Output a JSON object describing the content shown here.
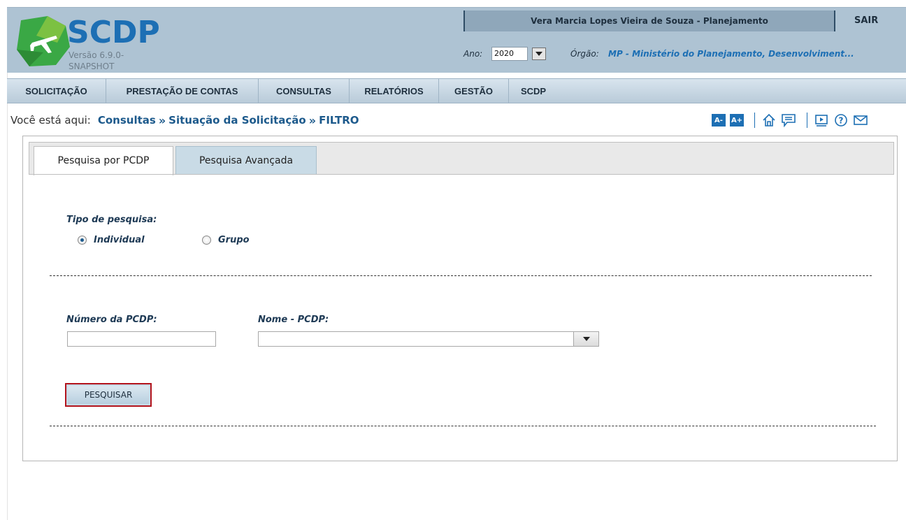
{
  "app": {
    "logo_title": "SCDP",
    "version": "Versão 6.9.0-SNAPSHOT"
  },
  "header": {
    "user": "Vera Marcia Lopes Vieira de Souza - Planejamento",
    "logout_label": "SAIR",
    "ano_label": "Ano:",
    "ano_value": "2020",
    "orgao_label": "Órgão:",
    "orgao_value": "MP - Ministério do Planejamento, Desenvolviment..."
  },
  "nav": {
    "items": [
      {
        "label": "SOLICITAÇÃO"
      },
      {
        "label": "PRESTAÇÃO DE CONTAS"
      },
      {
        "label": "CONSULTAS"
      },
      {
        "label": "RELATÓRIOS"
      },
      {
        "label": "GESTÃO"
      },
      {
        "label": "SCDP"
      }
    ]
  },
  "breadcrumb": {
    "prefix": "Você está aqui:",
    "items": [
      "Consultas",
      "Situação da Solicitação",
      "FILTRO"
    ],
    "separator": "»"
  },
  "toolbar": {
    "font_decrease": "A-",
    "font_increase": "A+",
    "icons": [
      "home-icon",
      "chat-icon",
      "video-icon",
      "help-icon",
      "mail-icon"
    ]
  },
  "tabs": [
    {
      "label": "Pesquisa por PCDP",
      "active": true
    },
    {
      "label": "Pesquisa Avançada",
      "active": false
    }
  ],
  "form": {
    "tipo_label": "Tipo de pesquisa:",
    "radio_individual": "Individual",
    "radio_grupo": "Grupo",
    "selected_radio": "Individual",
    "numero_label": "Número da PCDP:",
    "numero_value": "",
    "nome_label": "Nome - PCDP:",
    "nome_value": "",
    "search_button": "PESQUISAR"
  },
  "colors": {
    "header_bg": "#aec3d3",
    "brand_blue": "#1d6fb4",
    "logo_green": "#3aa845",
    "button_border": "#b3141d"
  }
}
